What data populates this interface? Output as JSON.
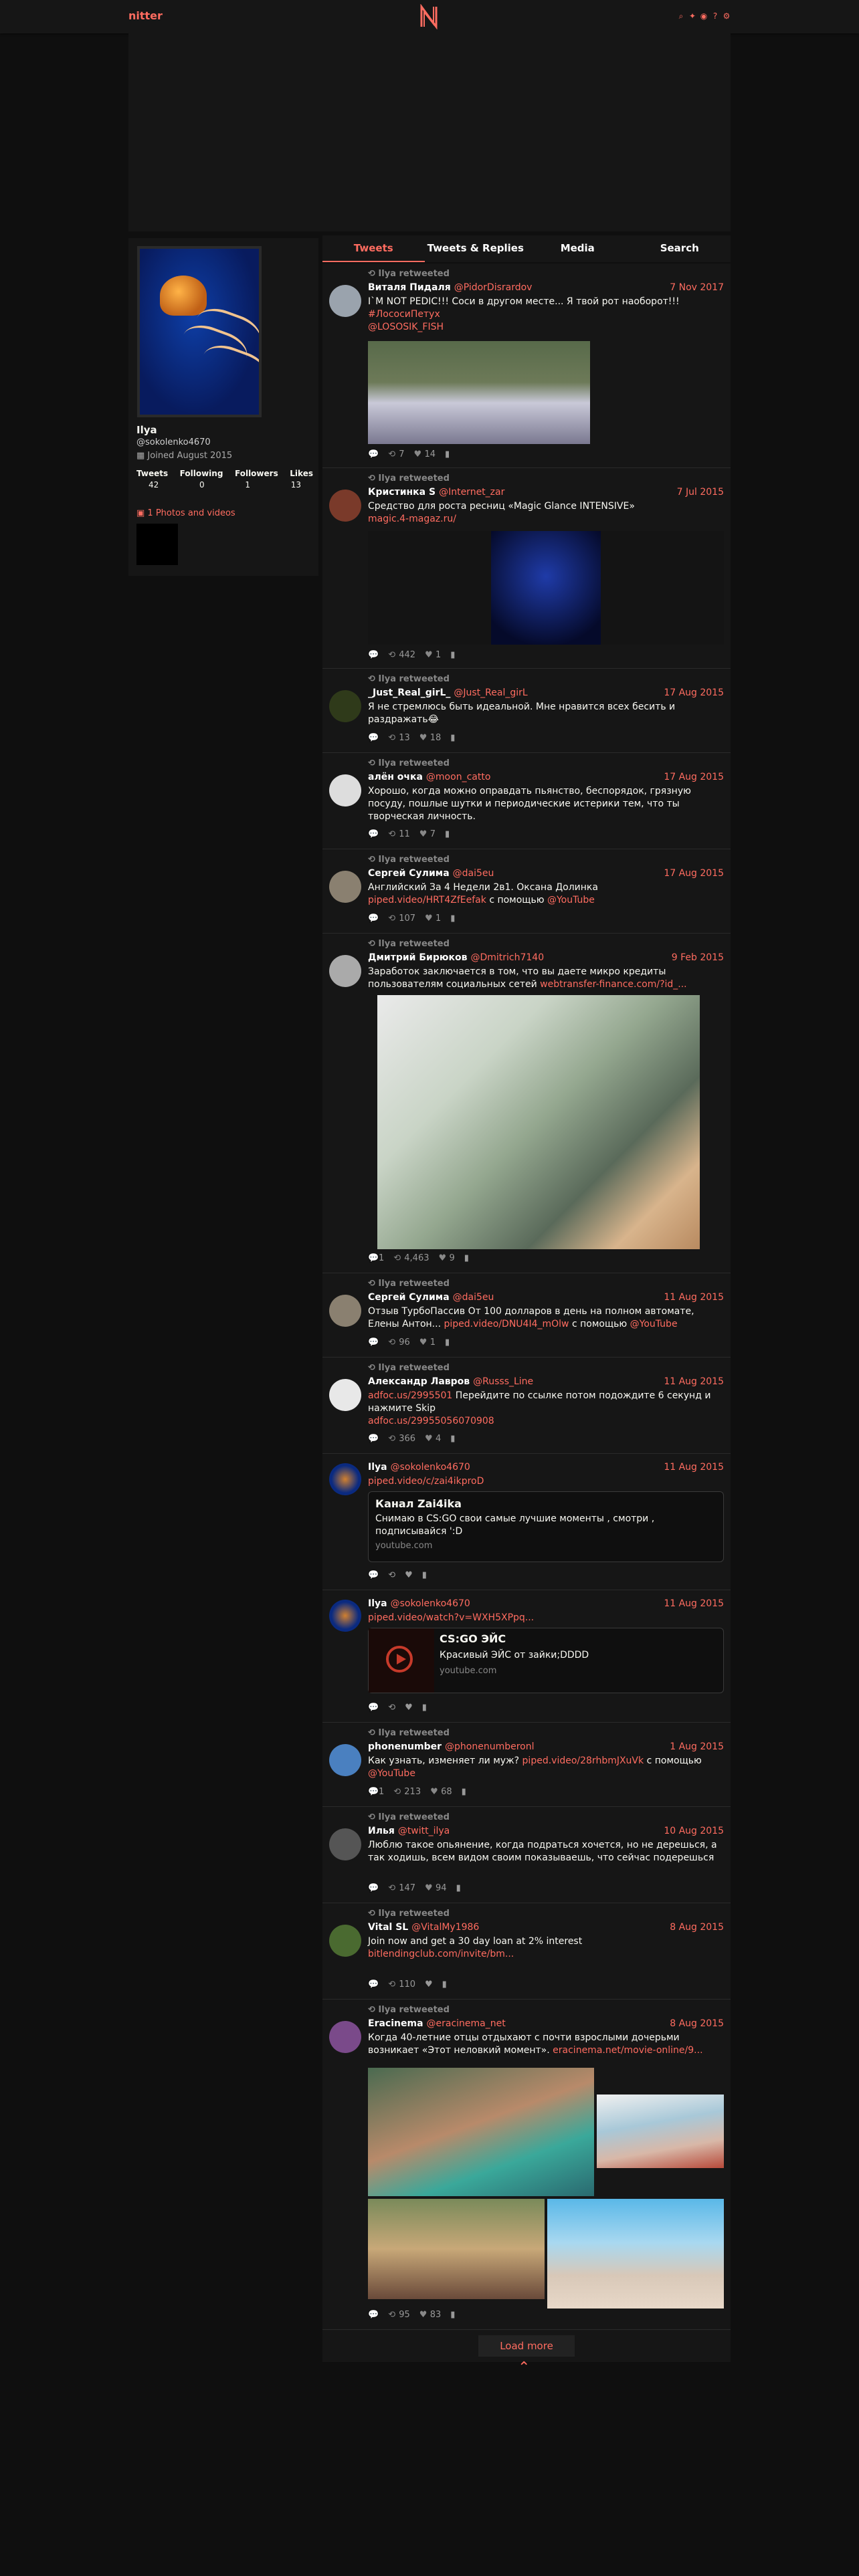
{
  "nav": {
    "brand": "nitter",
    "logo": "N"
  },
  "profile": {
    "fullname": "Ilya",
    "username": "@sokolenko4670",
    "joined": "Joined August 2015",
    "stats_labels": [
      "Tweets",
      "Following",
      "Followers",
      "Likes"
    ],
    "stats_values": [
      "42",
      "0",
      "1",
      "13"
    ],
    "media_link": "1 Photos and videos"
  },
  "tabs": [
    "Tweets",
    "Tweets & Replies",
    "Media",
    "Search"
  ],
  "tweets": [
    {
      "rt": "Ilya retweeted",
      "name": "Виталя Пидаля",
      "user": "@PidorDisrardov",
      "date": "7 Nov 2017",
      "text": "I`M NOT PEDIC!!! Соси в другом месте... Я твой рот наоборот!!!",
      "links": [
        "#ЛососиПетух",
        "@LOSOSIK_FISH"
      ],
      "stats": [
        "",
        "7",
        "14",
        ""
      ]
    },
    {
      "rt": "Ilya retweeted",
      "name": "Кристинка S",
      "user": "@Internet_zar",
      "date": "7 Jul 2015",
      "text": "Средство для роста ресниц «Magic Glance INTENSIVE»",
      "links": [
        "magic.4-magaz.ru/"
      ],
      "stats": [
        "",
        "442",
        "1",
        ""
      ]
    },
    {
      "rt": "Ilya retweeted",
      "name": "_Just_Real_girL_",
      "user": "@Just_Real_girL",
      "date": "17 Aug 2015",
      "text": "Я не стремлюсь быть идеальной. Мне нравится всех бесить и раздражать😂",
      "stats": [
        "",
        "13",
        "18",
        ""
      ]
    },
    {
      "rt": "Ilya retweeted",
      "name": "алён очка",
      "user": "@moon_catto",
      "date": "17 Aug 2015",
      "text": "Хорошо, когда можно оправдать пьянство, беспорядок, грязную посуду, пошлые шутки и периодические истерики тем, что ты творческая личность.",
      "stats": [
        "",
        "11",
        "7",
        ""
      ]
    },
    {
      "rt": "Ilya retweeted",
      "name": "Сергей Сулима",
      "user": "@dai5eu",
      "date": "17 Aug 2015",
      "text": "Английский За 4 Недели 2в1. Оксана Долинка",
      "links": [
        "piped.video/HRT4ZfEefak",
        "с помощью",
        "@YouTube"
      ],
      "stats": [
        "",
        "107",
        "1",
        ""
      ]
    },
    {
      "rt": "Ilya retweeted",
      "name": "Дмитрий Бирюков",
      "user": "@Dmitrich7140",
      "date": "9 Feb 2015",
      "text": "Заработок заключается в том, что вы даете микро кредиты пользователям социальных сетей",
      "links": [
        "webtransfer-finance.com/?id_..."
      ],
      "stats": [
        "1",
        "4,463",
        "9",
        ""
      ]
    },
    {
      "rt": "Ilya retweeted",
      "name": "Сергей Сулима",
      "user": "@dai5eu",
      "date": "11 Aug 2015",
      "text": "Отзыв ТурбоПассив От 100 долларов в день на полном автомате, Елены Антон...",
      "links": [
        "piped.video/DNU4I4_mOlw",
        "с помощью",
        "@YouTube"
      ],
      "stats": [
        "",
        "96",
        "1",
        ""
      ]
    },
    {
      "rt": "Ilya retweeted",
      "name": "Александр Лавров",
      "user": "@Russs_Line",
      "date": "11 Aug 2015",
      "text": "Перейдите по ссылке потом подождите 6 секунд и нажмите Skip",
      "links": [
        "adfoc.us/2995501",
        "adfoc.us/29955056070908"
      ],
      "stats": [
        "",
        "366",
        "4",
        ""
      ]
    },
    {
      "rt": "",
      "name": "Ilya",
      "user": "@sokolenko4670",
      "date": "11 Aug 2015",
      "text": "",
      "links": [
        "piped.video/c/zai4ikproD"
      ],
      "card": {
        "title": "Канал Zai4ika",
        "desc": "Снимаю в CS:GO свои самые лучшие моменты , смотри , подписывайся ':D",
        "domain": "youtube.com"
      },
      "stats": [
        "",
        "",
        "",
        ""
      ]
    },
    {
      "rt": "",
      "name": "Ilya",
      "user": "@sokolenko4670",
      "date": "11 Aug 2015",
      "text": "",
      "links": [
        "piped.video/watch?v=WXH5XPpq..."
      ],
      "card": {
        "title": "CS:GO ЭЙС",
        "desc": "Красивый ЭЙС от зайки;DDDD",
        "domain": "youtube.com"
      },
      "stats": [
        "",
        "",
        "",
        ""
      ]
    },
    {
      "rt": "Ilya retweeted",
      "name": "phonenumber",
      "user": "@phonenumberonl",
      "date": "1 Aug 2015",
      "text": "Как узнать, изменяет ли муж?",
      "links": [
        "piped.video/28rhbmJXuVk",
        "с помощью",
        "@YouTube"
      ],
      "stats": [
        "1",
        "213",
        "68",
        ""
      ]
    },
    {
      "rt": "Ilya retweeted",
      "name": "Илья",
      "user": "@twitt_ilya",
      "date": "10 Aug 2015",
      "text": "Люблю такое опьянение, когда подраться хочется, но не дерешься, а так ходишь, всем видом своим показываешь, что сейчас подерешься",
      "stats": [
        "",
        "147",
        "94",
        ""
      ]
    },
    {
      "rt": "Ilya retweeted",
      "name": "Vital SL",
      "user": "@VitalMy1986",
      "date": "8 Aug 2015",
      "text": "Join now and get a 30 day loan at 2% interest",
      "links": [
        "bitlendingclub.com/invite/bm..."
      ],
      "stats": [
        "",
        "110",
        "",
        ""
      ]
    },
    {
      "rt": "Ilya retweeted",
      "name": "Eracinema",
      "user": "@eracinema_net",
      "date": "8 Aug 2015",
      "text": "Когда 40-летние отцы отдыхают с почти взрослыми дочерьми возникает «Этот неловкий момент».",
      "links": [
        "eracinema.net/movie-online/9..."
      ],
      "stats": [
        "",
        "95",
        "83",
        ""
      ]
    }
  ],
  "load_more": "Load more",
  "colors": {
    "accent": "#ff6c60",
    "bg": "#0f0f0f",
    "panel": "#161616"
  }
}
